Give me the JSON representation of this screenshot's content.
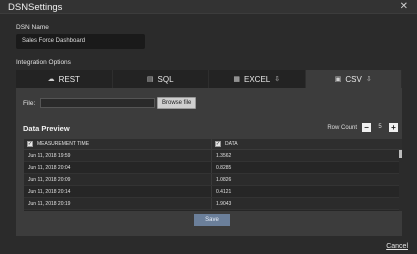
{
  "window": {
    "title": "DSNSettings"
  },
  "dsn": {
    "label": "DSN Name",
    "value": "Sales Force Dashboard"
  },
  "integration": {
    "label": "Integration Options",
    "tabs": [
      {
        "label": "REST",
        "icon": "cloud-icon",
        "glyph": "☁"
      },
      {
        "label": "SQL",
        "icon": "database-icon",
        "glyph": "▤"
      },
      {
        "label": "EXCEL",
        "icon": "excel-icon",
        "glyph": "▦",
        "sub": "⇩"
      },
      {
        "label": "CSV",
        "icon": "csv-icon",
        "glyph": "▣",
        "sub": "⇩"
      }
    ],
    "active_tab": "CSV"
  },
  "file": {
    "label": "File:",
    "browse": "Browse file"
  },
  "preview": {
    "title": "Data Preview",
    "row_count_label": "Row Count",
    "row_count": "5",
    "minus": "−",
    "plus": "+",
    "columns": [
      "MEASUREMENT TIME",
      "DATA"
    ],
    "check": "✓",
    "rows": [
      [
        "Jun 11, 2018 19:59",
        "1.3562"
      ],
      [
        "Jun 11, 2018 20:04",
        "0.8285"
      ],
      [
        "Jun 11, 2018 20:09",
        "1.0826"
      ],
      [
        "Jun 11, 2018 20:14",
        "0.4121"
      ],
      [
        "Jun 11, 2018 20:19",
        "1.9043"
      ]
    ]
  },
  "actions": {
    "save": "Save",
    "cancel": "Cancel"
  },
  "colors": {
    "accent": "#6b7f9a",
    "background": "#2b2b2b",
    "panel": "#3c3c3c"
  }
}
